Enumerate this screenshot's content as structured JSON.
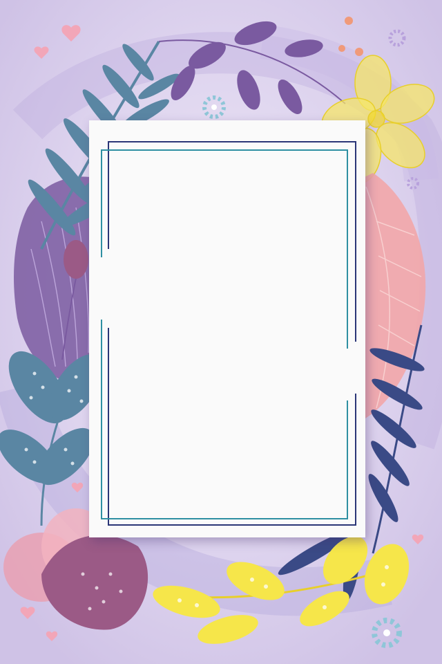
{
  "page": {
    "background_color": "#d9d0ec",
    "card_color": "#fafafa",
    "frame_line_navy": "#2a3577",
    "frame_line_teal": "#2e8fa2"
  },
  "decor": {
    "leaf_teal": "#5a86a3",
    "leaf_purple": "#7a5aa0",
    "leaf_navy": "#3a4a86",
    "leaf_pink": "#f2a6a8",
    "leaf_yellow": "#f6e64a",
    "flower_yellow": "#f5e66a",
    "flower_pink": "#e9a0b2",
    "flower_mauve": "#9b5a86"
  }
}
